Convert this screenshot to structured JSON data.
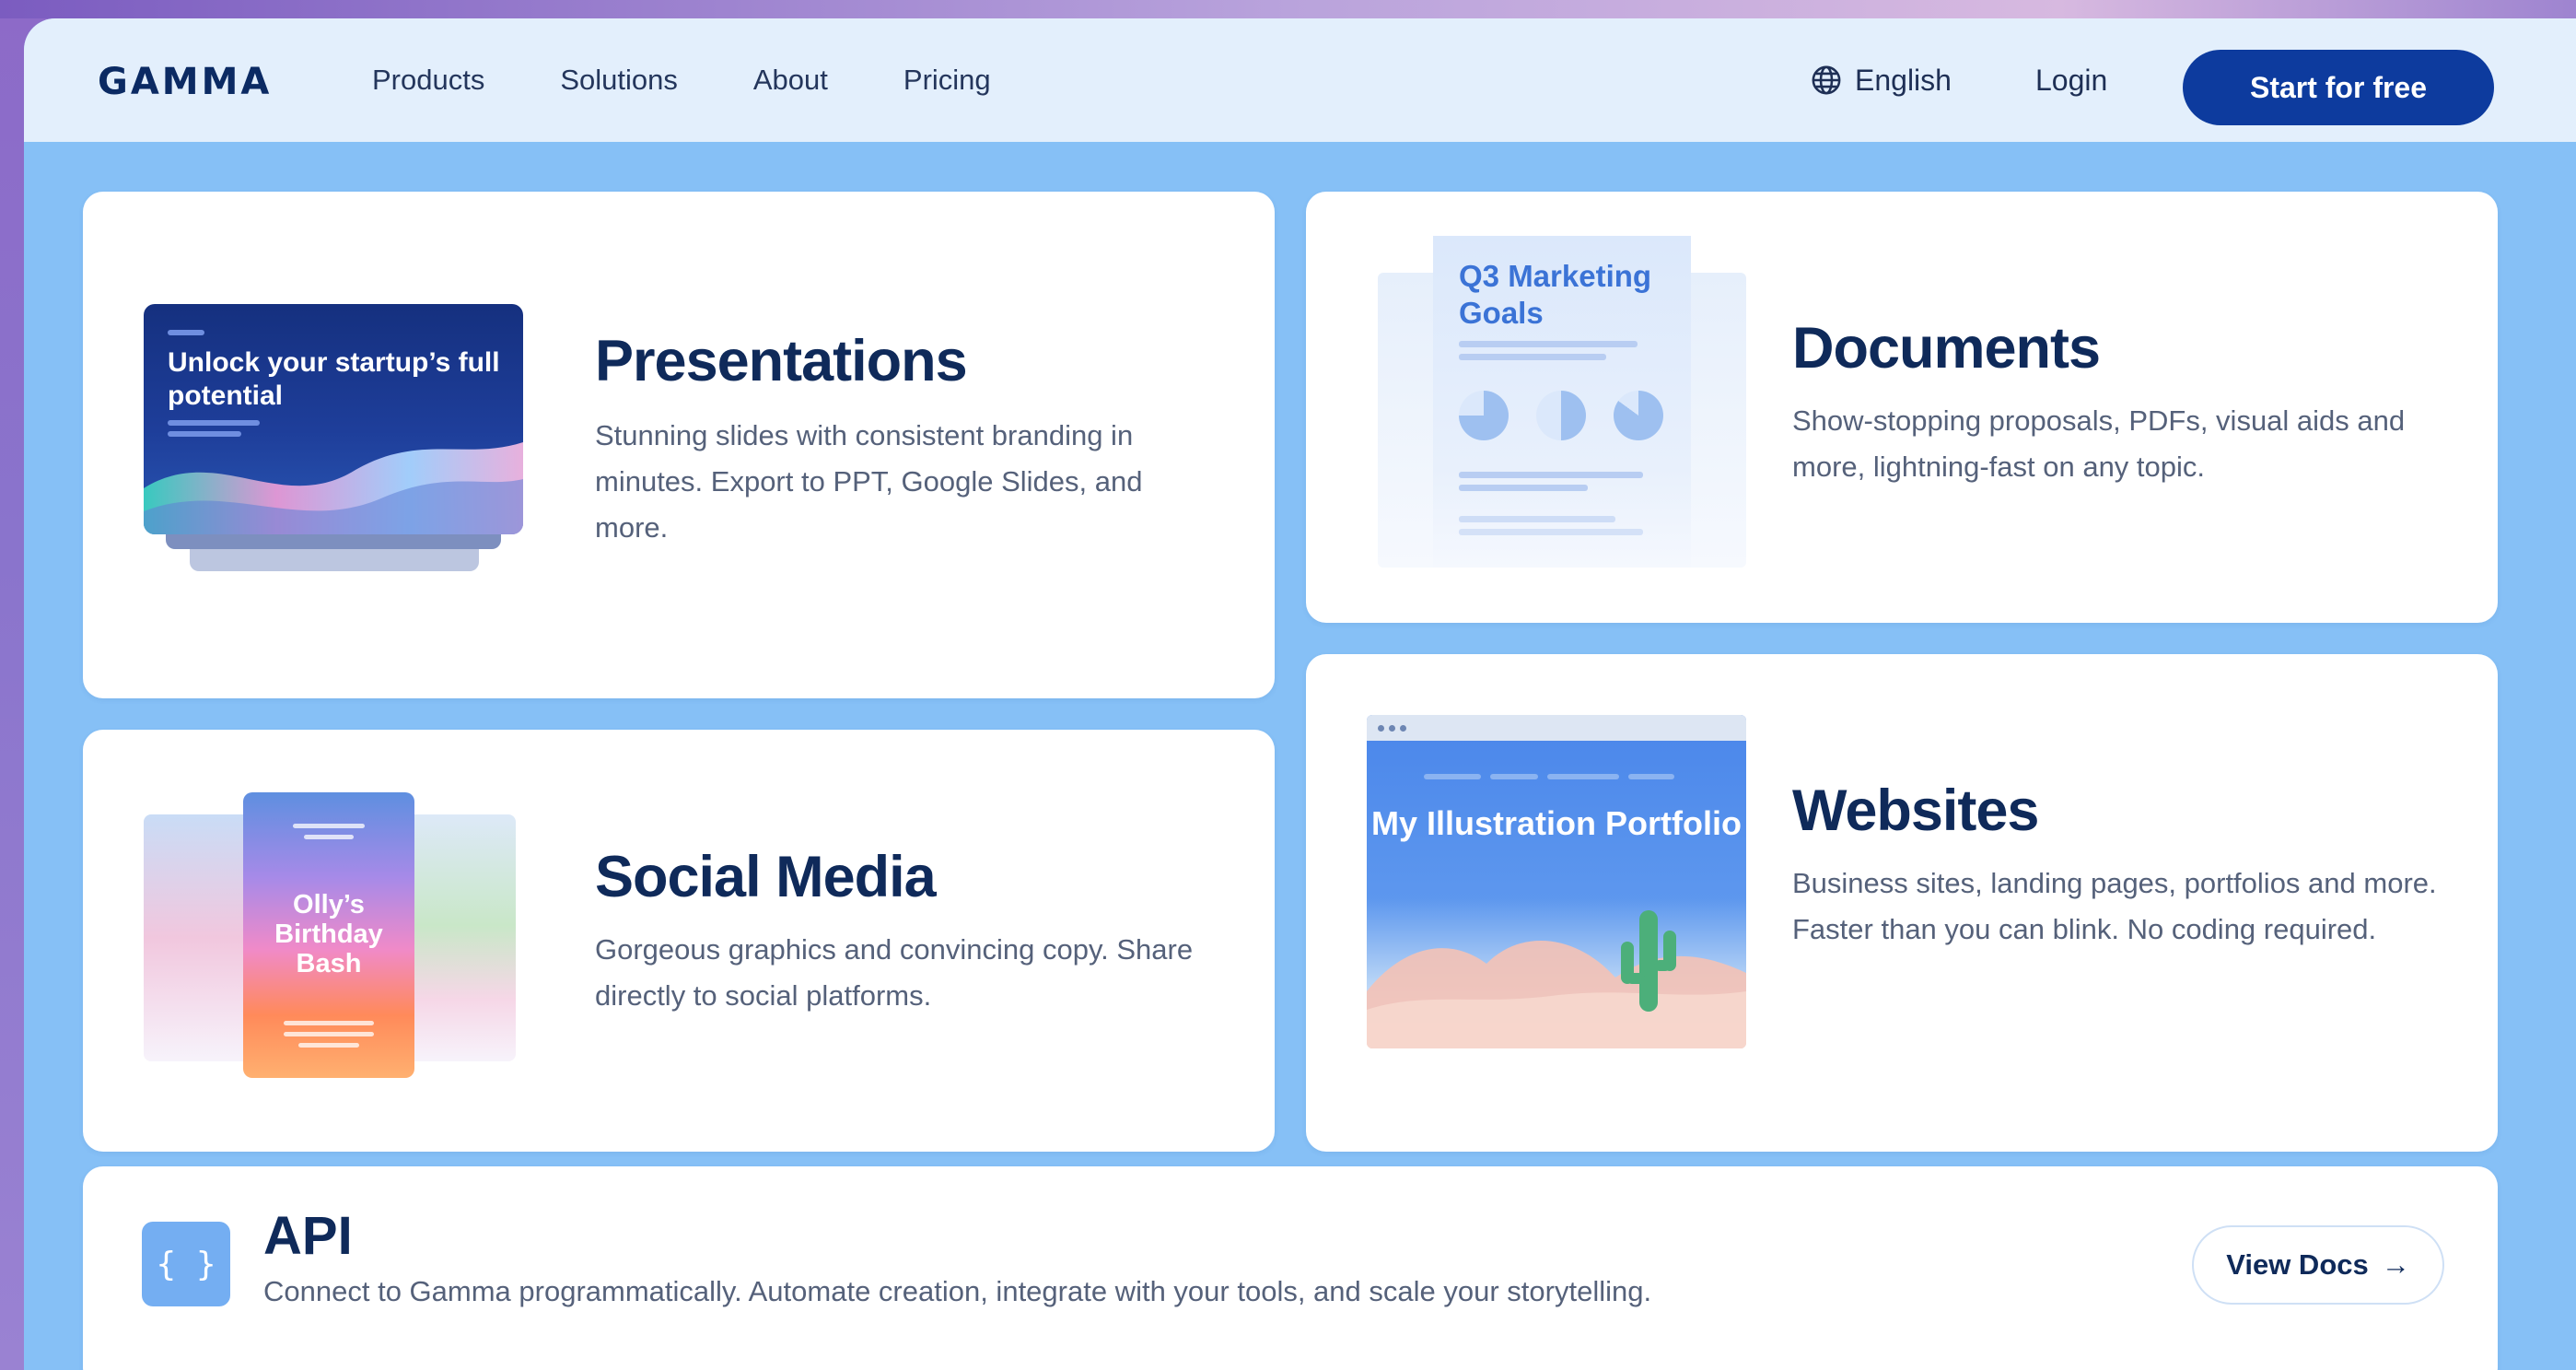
{
  "nav": {
    "logo": "GAMMA",
    "links": [
      "Products",
      "Solutions",
      "About",
      "Pricing"
    ],
    "language": "English",
    "login": "Login",
    "cta": "Start for free"
  },
  "cards": {
    "presentations": {
      "title": "Presentations",
      "description": "Stunning slides with consistent branding in minutes. Export to PPT, Google Slides, and more.",
      "illustration_text": "Unlock your startup’s full potential"
    },
    "documents": {
      "title": "Documents",
      "description": "Show-stopping proposals, PDFs, visual aids and more, lightning-fast on any topic.",
      "illustration_text": "Q3 Marketing Goals"
    },
    "social": {
      "title": "Social Media",
      "description": "Gorgeous graphics and convincing copy. Share directly to social platforms.",
      "illustration_text": "Olly’s Birthday Bash"
    },
    "websites": {
      "title": "Websites",
      "description": "Business sites, landing pages, portfolios and more. Faster than you can blink. No coding required.",
      "illustration_text": "My Illustration Portfolio"
    }
  },
  "api": {
    "icon": "{ }",
    "title": "API",
    "description": "Connect to Gamma programmatically. Automate creation, integrate with your tools, and scale your storytelling.",
    "button": "View Docs",
    "button_icon": "→"
  },
  "colors": {
    "accent": "#0d3b9e",
    "background": "#86c0f6",
    "nav_background": "#e3effc"
  }
}
